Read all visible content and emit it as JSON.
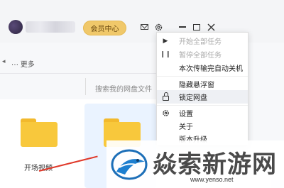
{
  "header": {
    "vip_label": "会员中心"
  },
  "toolbar": {
    "more_label": "更多",
    "search_placeholder": "搜索我的网盘文件"
  },
  "files": [
    {
      "name": "开场视频"
    },
    {
      "name": ""
    }
  ],
  "menu": {
    "items": [
      {
        "label": "开始全部任务",
        "icon": "play-icon",
        "enabled": false
      },
      {
        "label": "暂停全部任务",
        "icon": "pause-icon",
        "enabled": false
      },
      {
        "label": "本次传输完自动关机",
        "icon": "",
        "enabled": true
      },
      {
        "label": "隐藏悬浮窗",
        "icon": "",
        "enabled": true
      },
      {
        "label": "锁定网盘",
        "icon": "lock-icon",
        "enabled": true,
        "hovered": true
      },
      {
        "label": "设置",
        "icon": "gear-icon",
        "enabled": true
      },
      {
        "label": "关于",
        "icon": "",
        "enabled": true
      },
      {
        "label": "版本升级",
        "icon": "",
        "enabled": true
      }
    ]
  },
  "watermark": {
    "title": "焱索新游网",
    "url": "www.yenso.net"
  },
  "colors": {
    "vip_bg": "#f0c86a",
    "folder": "#f8c83c",
    "selection": "#eaf3ff",
    "annotation": "#e0392a"
  }
}
